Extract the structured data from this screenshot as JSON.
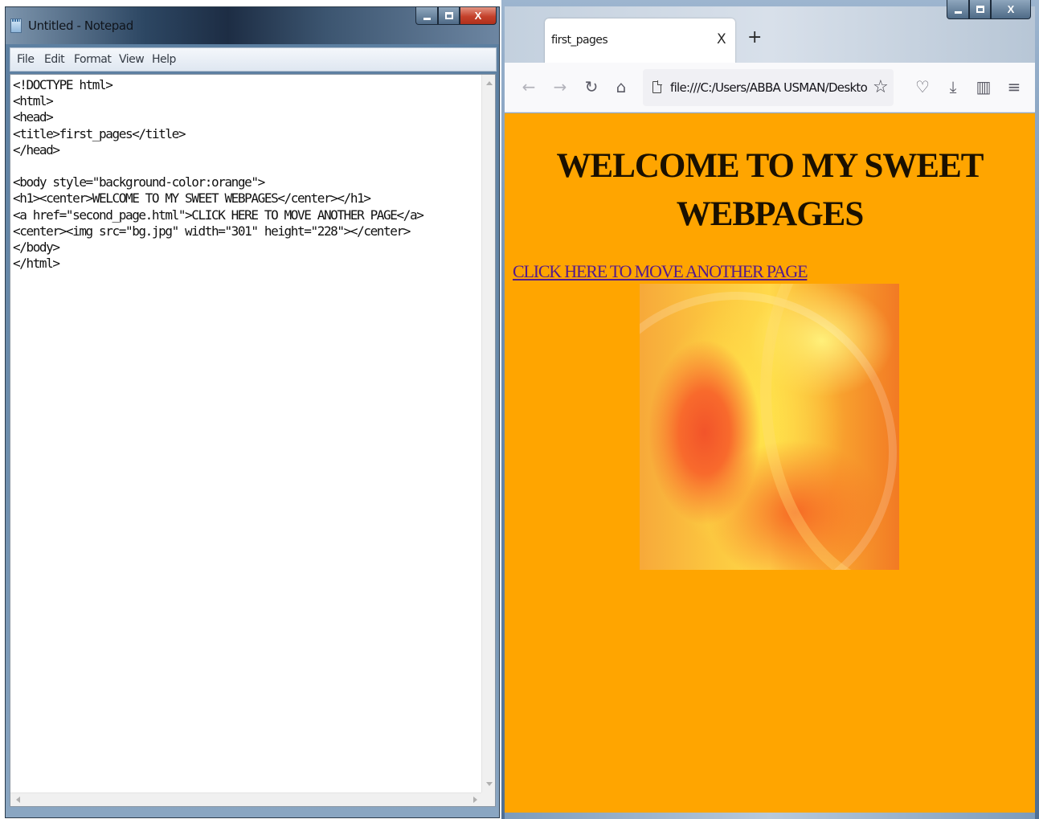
{
  "notepad": {
    "title": "Untitled - Notepad",
    "menu": [
      "File",
      "Edit",
      "Format",
      "View",
      "Help"
    ],
    "content": "<!DOCTYPE html>\n<html>\n<head>\n<title>first_pages</title>\n</head>\n\n<body style=\"background-color:orange\">\n<h1><center>WELCOME TO MY SWEET WEBPAGES</center></h1>\n<a href=\"second_page.html\">CLICK HERE TO MOVE ANOTHER PAGE</a>\n<center><img src=\"bg.jpg\" width=\"301\" height=\"228\"></center>\n</body>\n</html>",
    "controls": {
      "close": "X"
    }
  },
  "browser": {
    "tab_title": "first_pages",
    "tab_close": "X",
    "new_tab": "+",
    "url": "file:///C:/Users/ABBA USMAN/Desktop",
    "controls": {
      "close": "X"
    },
    "icons": [
      "back-icon",
      "forward-icon",
      "reload-icon",
      "home-icon",
      "page-icon",
      "bookmark-star-icon",
      "pocket-icon",
      "downloads-icon",
      "sidebar-icon",
      "menu-icon"
    ],
    "page": {
      "background": "#ffa500",
      "heading": "WELCOME TO MY SWEET WEBPAGES",
      "link": "CLICK HERE TO MOVE ANOTHER PAGE",
      "image_alt": "bg.jpg"
    }
  }
}
